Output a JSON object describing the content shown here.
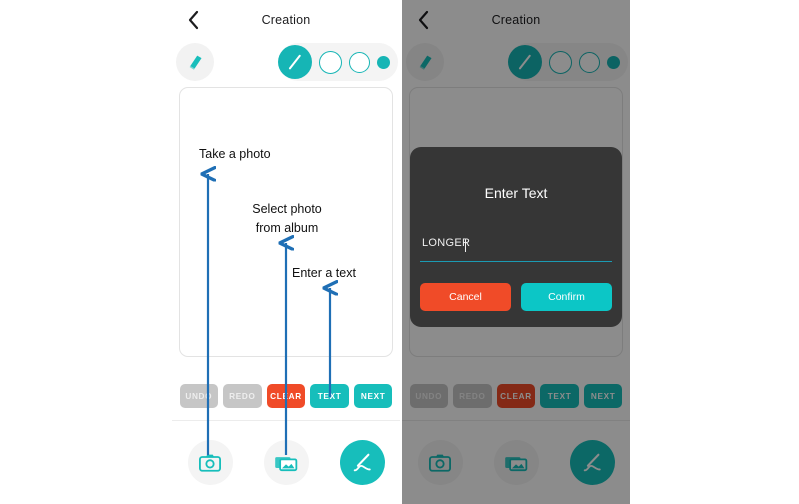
{
  "screens": [
    {
      "id": "drawing-screen",
      "nav": {
        "back_icon": "chevron-left-icon",
        "title": "Creation"
      },
      "tools": {
        "eraser_icon": "eraser-icon",
        "brushes": [
          {
            "name": "pen-selected",
            "state": "selected"
          },
          {
            "name": "brush-size-large",
            "state": "unselected"
          },
          {
            "name": "brush-size-medium",
            "state": "unselected"
          },
          {
            "name": "brush-size-small",
            "state": "unselected"
          }
        ]
      },
      "actions": [
        {
          "label": "UNDO",
          "style": "grey"
        },
        {
          "label": "REDO",
          "style": "grey"
        },
        {
          "label": "CLEAR",
          "style": "red"
        },
        {
          "label": "TEXT",
          "style": "teal"
        },
        {
          "label": "NEXT",
          "style": "teal"
        }
      ],
      "bottom_nav": [
        {
          "icon": "camera-icon",
          "style": "plain"
        },
        {
          "icon": "photos-icon",
          "style": "plain"
        },
        {
          "icon": "pen-icon",
          "style": "accent"
        }
      ],
      "dialog": null
    },
    {
      "id": "text-dialog-screen",
      "nav": {
        "back_icon": "chevron-left-icon",
        "title": "Creation"
      },
      "tools": {
        "eraser_icon": "eraser-icon",
        "brushes": [
          {
            "name": "pen-selected",
            "state": "selected"
          },
          {
            "name": "brush-size-large",
            "state": "unselected"
          },
          {
            "name": "brush-size-medium",
            "state": "unselected"
          },
          {
            "name": "brush-size-small",
            "state": "unselected"
          }
        ]
      },
      "actions": [
        {
          "label": "UNDO",
          "style": "grey"
        },
        {
          "label": "REDO",
          "style": "grey"
        },
        {
          "label": "CLEAR",
          "style": "red"
        },
        {
          "label": "TEXT",
          "style": "teal"
        },
        {
          "label": "NEXT",
          "style": "teal"
        }
      ],
      "bottom_nav": [
        {
          "icon": "camera-icon",
          "style": "plain"
        },
        {
          "icon": "photos-icon",
          "style": "plain"
        },
        {
          "icon": "pen-icon",
          "style": "accent"
        }
      ],
      "dialog": {
        "title": "Enter Text",
        "input_value": "LONGER",
        "input_placeholder": "",
        "cancel_label": "Cancel",
        "confirm_label": "Confirm"
      }
    }
  ],
  "annotations": [
    {
      "id": "take-a-photo",
      "text": "Take a photo"
    },
    {
      "id": "select-photo-l1",
      "text": "Select photo"
    },
    {
      "id": "select-photo-l2",
      "text": "from album"
    },
    {
      "id": "enter-a-text",
      "text": "Enter a text"
    }
  ],
  "colors": {
    "accent_teal": "#17bebb",
    "danger_red": "#f04b28",
    "disabled_grey": "#c6c6c6",
    "dialog_bg": "#363636",
    "annotation_blue": "#1f6fb5",
    "input_underline": "#1b9ab3"
  }
}
